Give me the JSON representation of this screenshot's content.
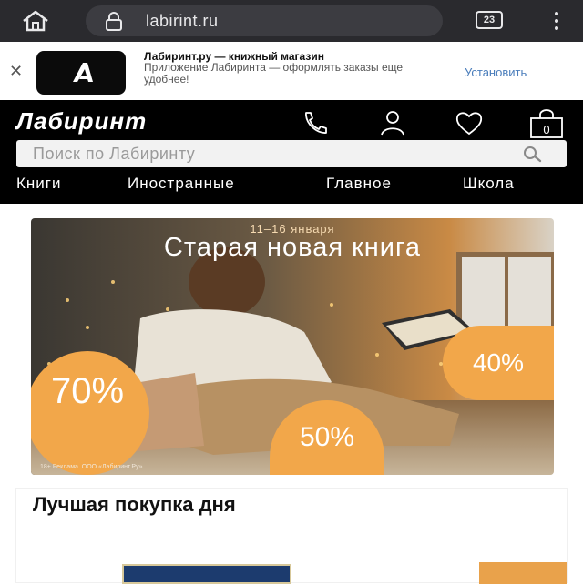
{
  "browser": {
    "url": "labirint.ru",
    "tab_count": "23"
  },
  "app_banner": {
    "title": "Лабиринт.ру — книжный магазин",
    "description": "Приложение Лабиринта — оформлять заказы еще удобнее!",
    "install_label": "Установить"
  },
  "site": {
    "logo": "Лабиринт",
    "search_placeholder": "Поиск по Лабиринту",
    "nav": [
      "Книги",
      "Иностранные",
      "Главное",
      "Школа"
    ]
  },
  "promo": {
    "dates": "11–16 января",
    "title": "Старая новая книга",
    "discounts": [
      "70%",
      "40%",
      "50%"
    ],
    "caption": "18+ Реклама. ООО «Лабиринт.Ру»"
  },
  "best_buy": {
    "title": "Лучшая покупка дня"
  },
  "colors": {
    "header_bg": "#000000",
    "browser_bar": "#2a2a2e",
    "accent_link": "#4a7dbb",
    "discount_orange": "#f2a74a"
  },
  "icons": [
    "home-icon",
    "lock-icon",
    "tabs-icon",
    "more-menu-icon",
    "close-icon",
    "phone-icon",
    "user-icon",
    "heart-icon",
    "cart-icon",
    "search-icon"
  ]
}
